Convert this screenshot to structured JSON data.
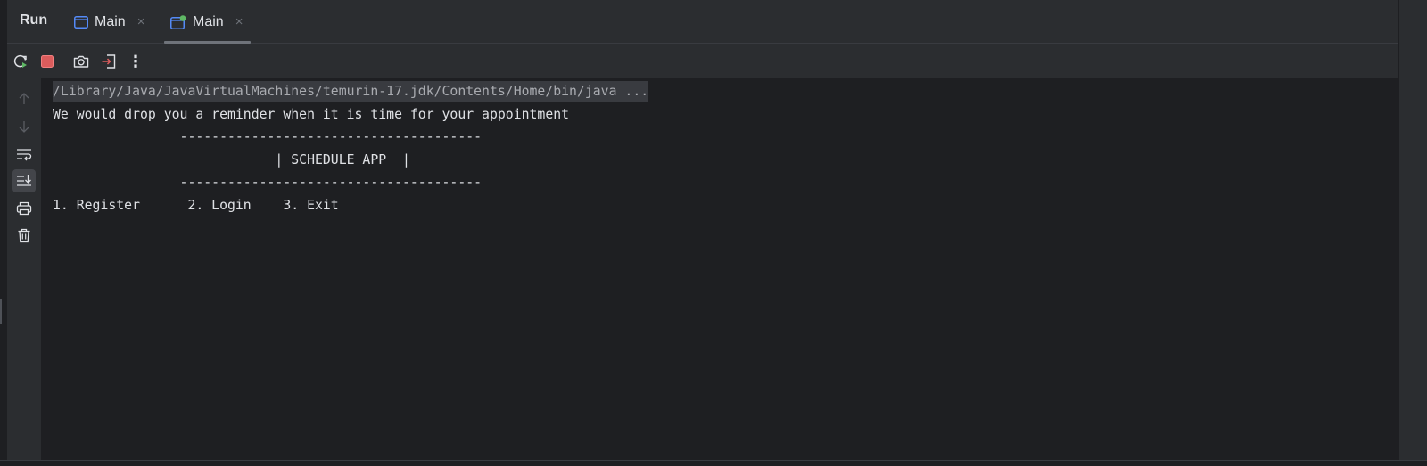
{
  "run_panel": {
    "title": "Run",
    "tabs": [
      {
        "label": "Main",
        "close": "×",
        "active": false
      },
      {
        "label": "Main",
        "close": "×",
        "active": true
      }
    ]
  },
  "toolbar": {
    "rerun_icon": "rerun-icon",
    "stop_icon": "stop-icon",
    "screenshot_icon": "camera-icon",
    "exit_icon": "exit-icon",
    "more_icon": "more-vertical-icon",
    "more_label": "⋮"
  },
  "gutter": {
    "icons": [
      "arrow-up-icon",
      "arrow-down-icon",
      "soft-wrap-icon",
      "scroll-to-end-icon",
      "print-icon",
      "trash-icon"
    ]
  },
  "console": {
    "lines": [
      "/Library/Java/JavaVirtualMachines/temurin-17.jdk/Contents/Home/bin/java ...",
      "We would drop you a reminder when it is time for your appointment",
      "                --------------------------------------",
      "                            | SCHEDULE APP  |",
      "                --------------------------------------",
      "1. Register      2. Login    3. Exit"
    ]
  },
  "colors": {
    "accent_green": "#5fb865",
    "stop_red": "#db5c5c",
    "tab_icon_blue": "#548af7"
  }
}
